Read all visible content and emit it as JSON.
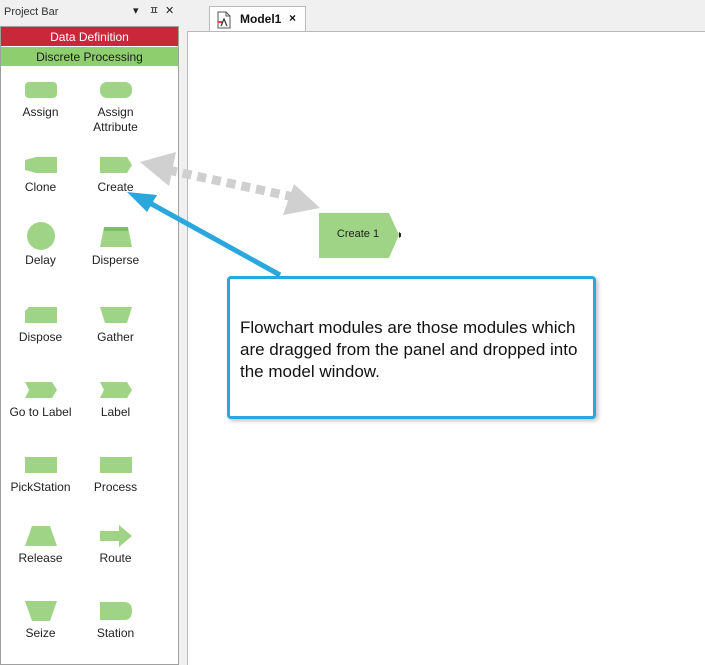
{
  "project_bar": {
    "title": "Project Bar",
    "pin_glyph": "▾",
    "dock_glyph": "ㅍ",
    "close_glyph": "✕",
    "panels": {
      "data_definition": "Data Definition",
      "discrete_processing": "Discrete Processing"
    },
    "modules": [
      {
        "label": "Assign",
        "shape": "assign-shape-icon"
      },
      {
        "label": "Assign\nAttribute",
        "shape": "assign-attribute-shape-icon"
      },
      {
        "label": "Clone",
        "shape": "clone-shape-icon"
      },
      {
        "label": "Create",
        "shape": "create-shape-icon"
      },
      {
        "label": "Delay",
        "shape": "delay-shape-icon"
      },
      {
        "label": "Disperse",
        "shape": "disperse-shape-icon"
      },
      {
        "label": "Dispose",
        "shape": "dispose-shape-icon"
      },
      {
        "label": "Gather",
        "shape": "gather-shape-icon"
      },
      {
        "label": "Go to Label",
        "shape": "go-to-label-shape-icon"
      },
      {
        "label": "Label",
        "shape": "label-shape-icon"
      },
      {
        "label": "PickStation",
        "shape": "pickstation-shape-icon"
      },
      {
        "label": "Process",
        "shape": "process-shape-icon"
      },
      {
        "label": "Release",
        "shape": "release-shape-icon"
      },
      {
        "label": "Route",
        "shape": "route-shape-icon"
      },
      {
        "label": "Seize",
        "shape": "seize-shape-icon"
      },
      {
        "label": "Station",
        "shape": "station-shape-icon"
      }
    ]
  },
  "model_tab": {
    "label": "Model1",
    "close_glyph": "×"
  },
  "canvas": {
    "create_module_label": "Create 1"
  },
  "callout": {
    "text": "Flowchart modules are those modules which are dragged from the panel and dropped into the model window."
  },
  "colors": {
    "module_green": "#9fd486",
    "data_definition_red": "#c8283a",
    "discrete_processing_green": "#8fce6e",
    "callout_blue": "#2aa7dc"
  }
}
